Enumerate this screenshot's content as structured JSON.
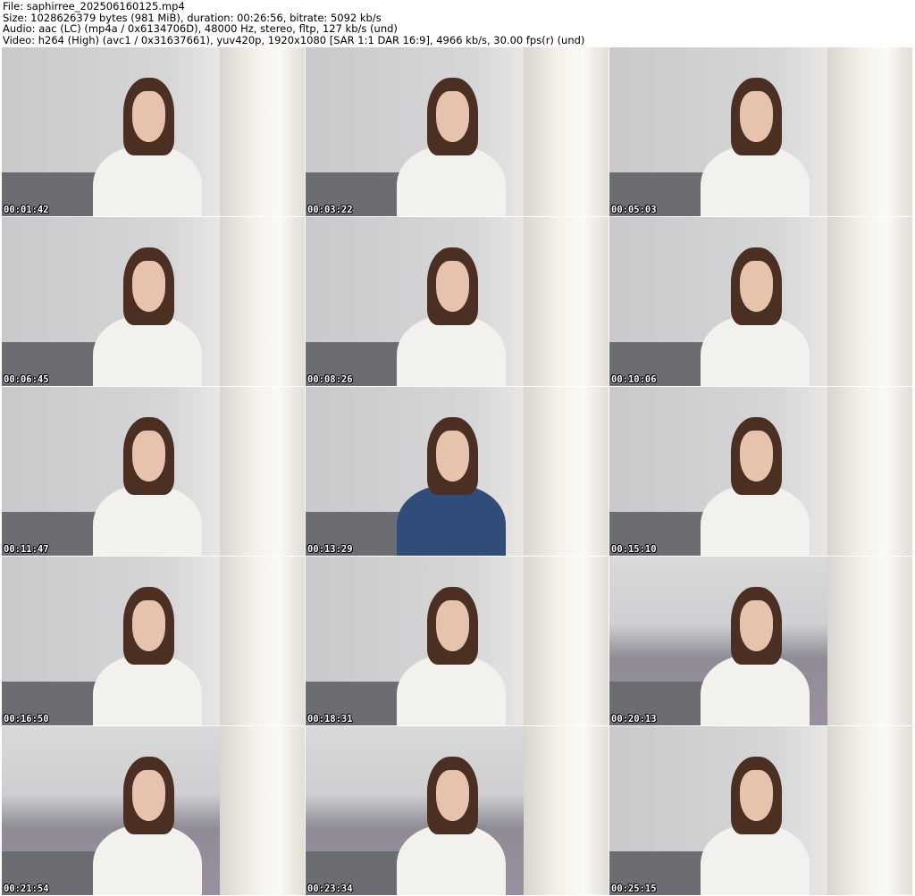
{
  "header": {
    "file": "File: saphirree_202506160125.mp4",
    "size": "Size: 1028626379 bytes (981 MiB), duration: 00:26:56, bitrate: 5092 kb/s",
    "audio": "Audio: aac (LC) (mp4a / 0x6134706D), 48000 Hz, stereo, fltp, 127 kb/s (und)",
    "video": "Video: h264 (High) (avc1 / 0x31637661), yuv420p, 1920x1080 [SAR 1:1 DAR 16:9], 4966 kb/s, 30.00 fps(r) (und)"
  },
  "thumbnails": [
    {
      "time": "00:01:42"
    },
    {
      "time": "00:03:22"
    },
    {
      "time": "00:05:03"
    },
    {
      "time": "00:06:45"
    },
    {
      "time": "00:08:26"
    },
    {
      "time": "00:10:06"
    },
    {
      "time": "00:11:47"
    },
    {
      "time": "00:13:29"
    },
    {
      "time": "00:15:10"
    },
    {
      "time": "00:16:50"
    },
    {
      "time": "00:18:31"
    },
    {
      "time": "00:20:13"
    },
    {
      "time": "00:21:54"
    },
    {
      "time": "00:23:34"
    },
    {
      "time": "00:25:15"
    }
  ]
}
